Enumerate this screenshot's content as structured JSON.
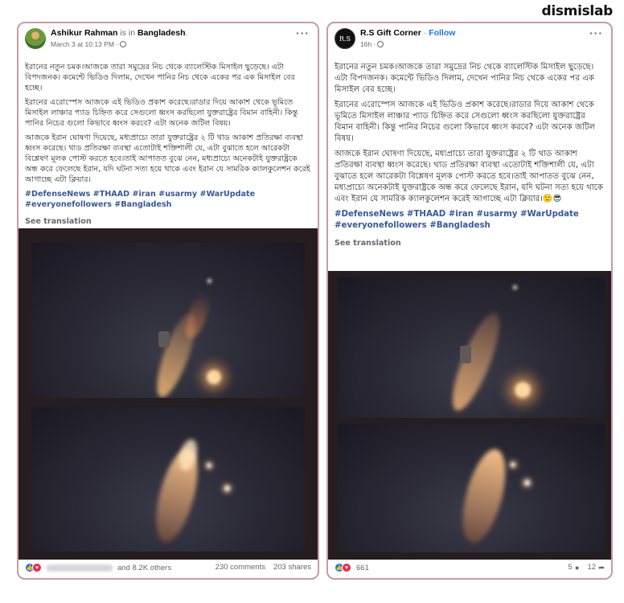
{
  "brand": "dismislab",
  "left_post": {
    "author": "Ashikur Rahman",
    "location_prefix": "is in",
    "location": "Bangladesh",
    "timestamp": "March 3 at 10:13 PM ·",
    "paragraphs": [
      "ইরানের নতুন চমক।আজকে তারা সমুদ্রের নিচ থেকে ব্যালেস্টিক মিসাইল ছুড়েছে। এটা বিপদজনক। কমেন্টে ভিডিও দিলাম, দেখেন পানির নিচ থেকে একের পর এক মিসাইল বের হচ্ছে।",
      "ইরানের এরোস্পেস আজকে এই ভিডিও প্রকাশ করেছে।রাডার দিয়ে আকাশ থেকে ভূমিতে মিসাইল লাঞ্চার প্যাড চিহ্নিত করে সেগুলো ধ্বংস করছিলো যুক্তরাষ্ট্রের বিমান বাহিনী। কিন্তু পানির নিচের গুলো কিভাবে ধ্বংস করবে? এটা অনেক জটিল বিষয়।",
      "আজকে ইরান ঘোষণা দিয়েছে, মধ্যপ্রাচ্যে তারা যুক্তরাষ্ট্রের ২ টি থাড আকাশ প্রতিরক্ষা ব্যবস্থা ধ্বংস করেছে। থাড প্রতিরক্ষা ব্যবস্থা এতোটাই শক্তিশালী যে, এটা বুঝাতে হলে আরেকটা বিশ্লেষণ মূলক পোস্ট করতে হবে।তাই আপাতত বুঝে নেন, মধ্যপ্রাচ্যে অনেকটাই যুক্তরাষ্ট্রকে অন্ধ করে ফেলেছে ইরান, যদি ঘটনা সত্য হয়ে থাকে এবং ইরান যে সামরিক ক্যালকুলেশন করেই আগাচ্ছে এটা ক্লিয়ার।"
    ],
    "hashtags": "#DefenseNews #THAAD #iran #usarmy #WarUpdate #everyonefollowers #Bangladesh",
    "see_translation": "See translation",
    "reactions_text": "and 8.2K others",
    "comments": "230 comments",
    "shares": "203 shares"
  },
  "right_post": {
    "author": "R.S Gift Corner",
    "follow_label": "Follow",
    "avatar_text": "R.S",
    "timestamp": "16h ·",
    "paragraphs": [
      "ইরানের নতুন চমক।আজকে তারা সমুদ্রের নিচ থেকে ব্যালেস্টিক মিসাইল ছুড়েছে। এটা বিপদজনক। কমেন্টে ভিডিও দিলাম, দেখেন পানির নিচ থেকে একের পর এক মিসাইল বের হচ্ছে।",
      "ইরানের এরোস্পেস আজকে এই ভিডিও প্রকাশ করেছে।রাডার দিয়ে আকাশ থেকে ভূমিতে মিসাইল লাঞ্চার প্যাড চিহ্নিত করে সেগুলো ধ্বংস করছিলো যুক্তরাষ্ট্রের বিমান বাহিনী। কিন্তু পানির নিচের গুলো কিভাবে ধ্বংস করবে? এটা অনেক জটিল বিষয়।",
      "আজকে ইরান ঘোষণা দিয়েছে, মধ্যপ্রাচ্যে তারা যুক্তরাষ্ট্রের ২ টি থাড আকাশ প্রতিরক্ষা ব্যবস্থা ধ্বংস করেছে। থাড প্রতিরক্ষা ব্যবস্থা এতোটাই শক্তিশালী যে, এটা বুঝাতে হলে আরেকটা বিশ্লেষণ মূলক পোস্ট করতে হবে।তাই আপাতত বুঝে নেন, মধ্যপ্রাচ্যে অনেকটাই যুক্তরাষ্ট্রকে অন্ধ করে ফেলেছে ইরান, যদি ঘটনা সত্য হয়ে থাকে এবং ইরান যে সামরিক ক্যালকুলেশন করেই আগাচ্ছে এটা ক্লিয়ার।🙂😎"
    ],
    "hashtags": "#DefenseNews #THAAD #iran #usarmy #WarUpdate #everyonefollowers #Bangladesh",
    "see_translation": "See translation",
    "reactions_count": "661",
    "comments_count": "5",
    "shares_count": "12"
  },
  "icons": {
    "more": "more-options-icon",
    "globe": "globe-icon",
    "like": "like-reaction-icon",
    "love": "love-reaction-icon",
    "comment": "comment-icon",
    "share": "share-icon"
  },
  "colors": {
    "border": "#c99aa8",
    "link": "#1877f2",
    "hashtag": "#385898",
    "video_bg": "#251d1f"
  }
}
